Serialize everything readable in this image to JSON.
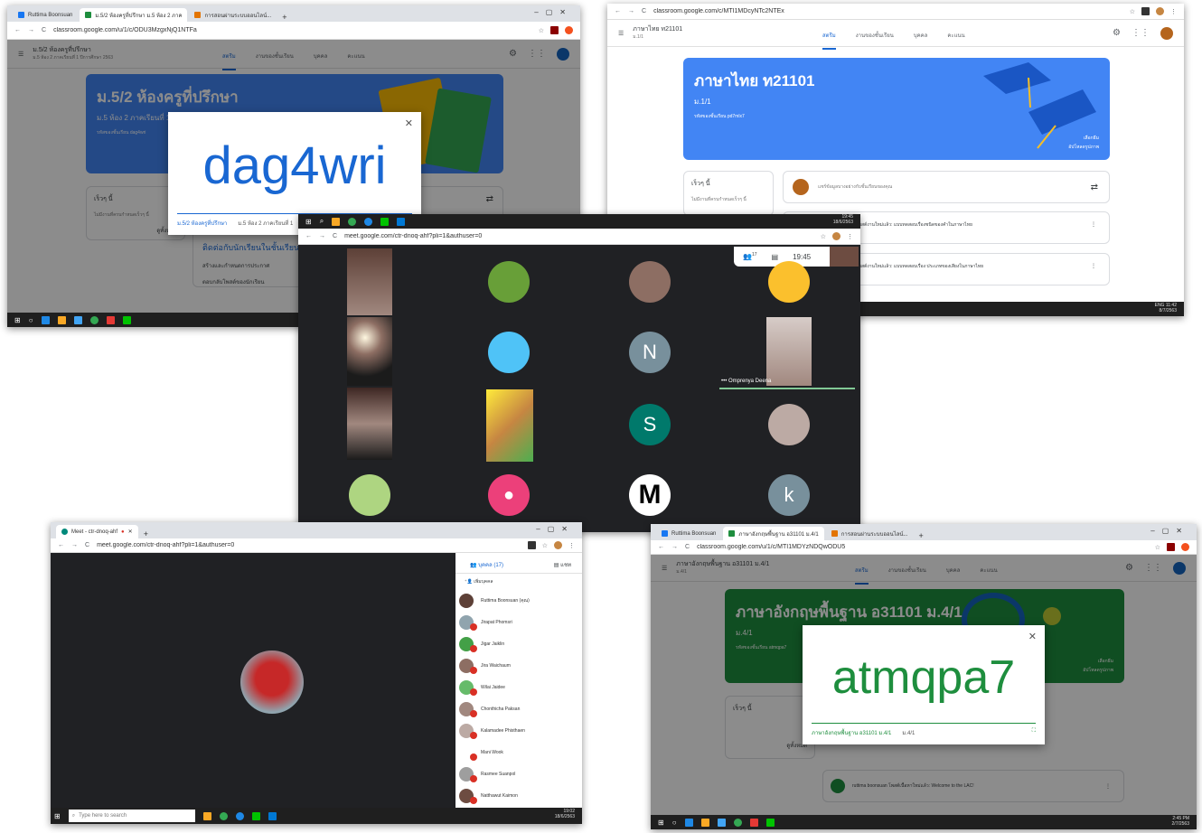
{
  "shot1": {
    "tabs": [
      "Ruttima Boonsuan",
      "ม.5/2 ห้องครูที่ปรึกษา ม.5 ห้อง 2 ภาค",
      "การสอนผ่านระบบออนไลน์..."
    ],
    "url": "classroom.google.com/u/1/c/ODU3MzgxNjQ1NTFa",
    "class_title": "ม.5/2 ห้องครูที่ปรึกษา",
    "class_sub": "ม.5 ห้อง 2 ภาคเรียนที่ 1 ปีการศึกษา 2563",
    "nav": [
      "สตรีม",
      "งานของชั้นเรียน",
      "บุคคล",
      "คะแนน"
    ],
    "banner_title": "ม.5/2 ห้องครูที่ปรึกษา",
    "banner_sub": "ม.5 ห้อง 2 ภาคเรียนที่ 1 ปีการศึกษา 2563",
    "banner_code_label": "รหัสของชั้นเรียน dag4wri",
    "upcoming": "เร็วๆ นี้",
    "no_work": "ไม่มีงานที่ครบกำหนดเร็วๆ นี้",
    "view_all": "ดูทั้งหมด",
    "stream_heading": "ติดต่อกับนักเรียนในชั้นเรียน",
    "stream_item1": "สร้างและกำหนดการประกาศ",
    "stream_item2": "ตอบกลับโพสต์ของนักเรียน",
    "modal_code": "dag4wri",
    "modal_foot1": "ม.5/2 ห้องครูที่ปรึกษา",
    "modal_foot2": "ม.5 ห้อง 2 ภาคเรียนที่ 1"
  },
  "shot2": {
    "url": "classroom.google.com/c/MTI1MDcyNTc2NTEx",
    "class_title": "ภาษาไทย ท21101",
    "class_sub": "ม.1/1",
    "nav": [
      "สตรีม",
      "งานของชั้นเรียน",
      "บุคคล",
      "คะแนน"
    ],
    "banner_title": "ภาษาไทย ท21101",
    "banner_sub": "ม.1/1",
    "banner_code_label": "รหัสของชั้นเรียน pd7mlx7",
    "banner_right1": "เลือกธีม",
    "banner_right2": "อัปโหลดรูปภาพ",
    "upcoming": "เร็วๆ นี้",
    "no_work": "ไม่มีงานที่ครบกำหนดเร็วๆ นี้",
    "post_placeholder": "แชร์ข้อมูลบางอย่างกับชั้นเรียนของคุณ",
    "post1": "โพสต์งานใหม่แล้ว: แบบทดสอบเรื่องชนิดของคำในภาษาไทย",
    "post2": "โพสต์งานใหม่แล้ว: แบบทดสอบเรื่อง ประเภทของเสียงในภาษาไทย",
    "tray_lang": "ENG",
    "tray_time": "11:42",
    "tray_date": "8/7/2563"
  },
  "shot3": {
    "url": "meet.google.com/ctr-dnoq-ahf?pli=1&authuser=0",
    "participants_count": "17",
    "clock": "19:45",
    "tray_time": "19:45",
    "tray_date": "18/6/2563",
    "named_tile": "Omprenya Deena",
    "letter_n": "N",
    "letter_s": "S",
    "letter_m": "M",
    "letter_k": "k"
  },
  "shot4": {
    "tab": "Meet - ctr-dnoq-ahf",
    "url": "meet.google.com/ctr-dnoq-ahf?pli=1&authuser=0",
    "people_tab": "บุคคล (17)",
    "chat_tab": "แชท",
    "add_people": "เพิ่มบุคคล",
    "people": [
      "Ruttima Boonsuan (คุณ)",
      "Jirapat Phomsri",
      "Jigar Jaiklin",
      "Jira Waichaum",
      "Wilai Jaidee",
      "Chonthicha Paksan",
      "Kalamadee Phisthaen",
      "Mani Wook",
      "Rasmee Suanpol",
      "Natthawut Kaimon"
    ],
    "search_placeholder": "Type here to search",
    "tray_time": "19:02",
    "tray_date": "18/6/2563"
  },
  "shot5": {
    "tabs": [
      "Ruttima Boonsuan",
      "ภาษาอังกฤษพื้นฐาน อ31101 ม.4/1",
      "การสอนผ่านระบบออนไลน์..."
    ],
    "url": "classroom.google.com/u/1/c/MTI1MDYzNDQwODU5",
    "class_title": "ภาษาอังกฤษพื้นฐาน อ31101 ม.4/1",
    "class_sub": "ม.4/1",
    "nav": [
      "สตรีม",
      "งานของชั้นเรียน",
      "บุคคล",
      "คะแนน"
    ],
    "banner_title": "ภาษาอังกฤษพื้นฐาน อ31101 ม.4/1",
    "banner_sub": "ม.4/1",
    "banner_code_label": "รหัสของชั้นเรียน atmqpa7",
    "banner_right1": "เลือกธีม",
    "banner_right2": "อัปโหลดรูปภาพ",
    "upcoming": "เร็วๆ นี้",
    "view_all": "ดูทั้งหมด",
    "post_text": "ruttima boonsuan โพสต์เนื้อหาใหม่แล้ว: Welcome to the LAC!",
    "modal_code": "atmqpa7",
    "modal_foot1": "ภาษาอังกฤษพื้นฐาน อ31101 ม.4/1",
    "modal_foot2": "ม.4/1",
    "tray_time": "2:45 PM",
    "tray_date": "2/7/2563"
  },
  "colors": {
    "classroom_blue": "#4285f4",
    "classroom_green": "#1e8e3e",
    "meet_dark": "#202124",
    "accent_blue": "#1967d2"
  }
}
